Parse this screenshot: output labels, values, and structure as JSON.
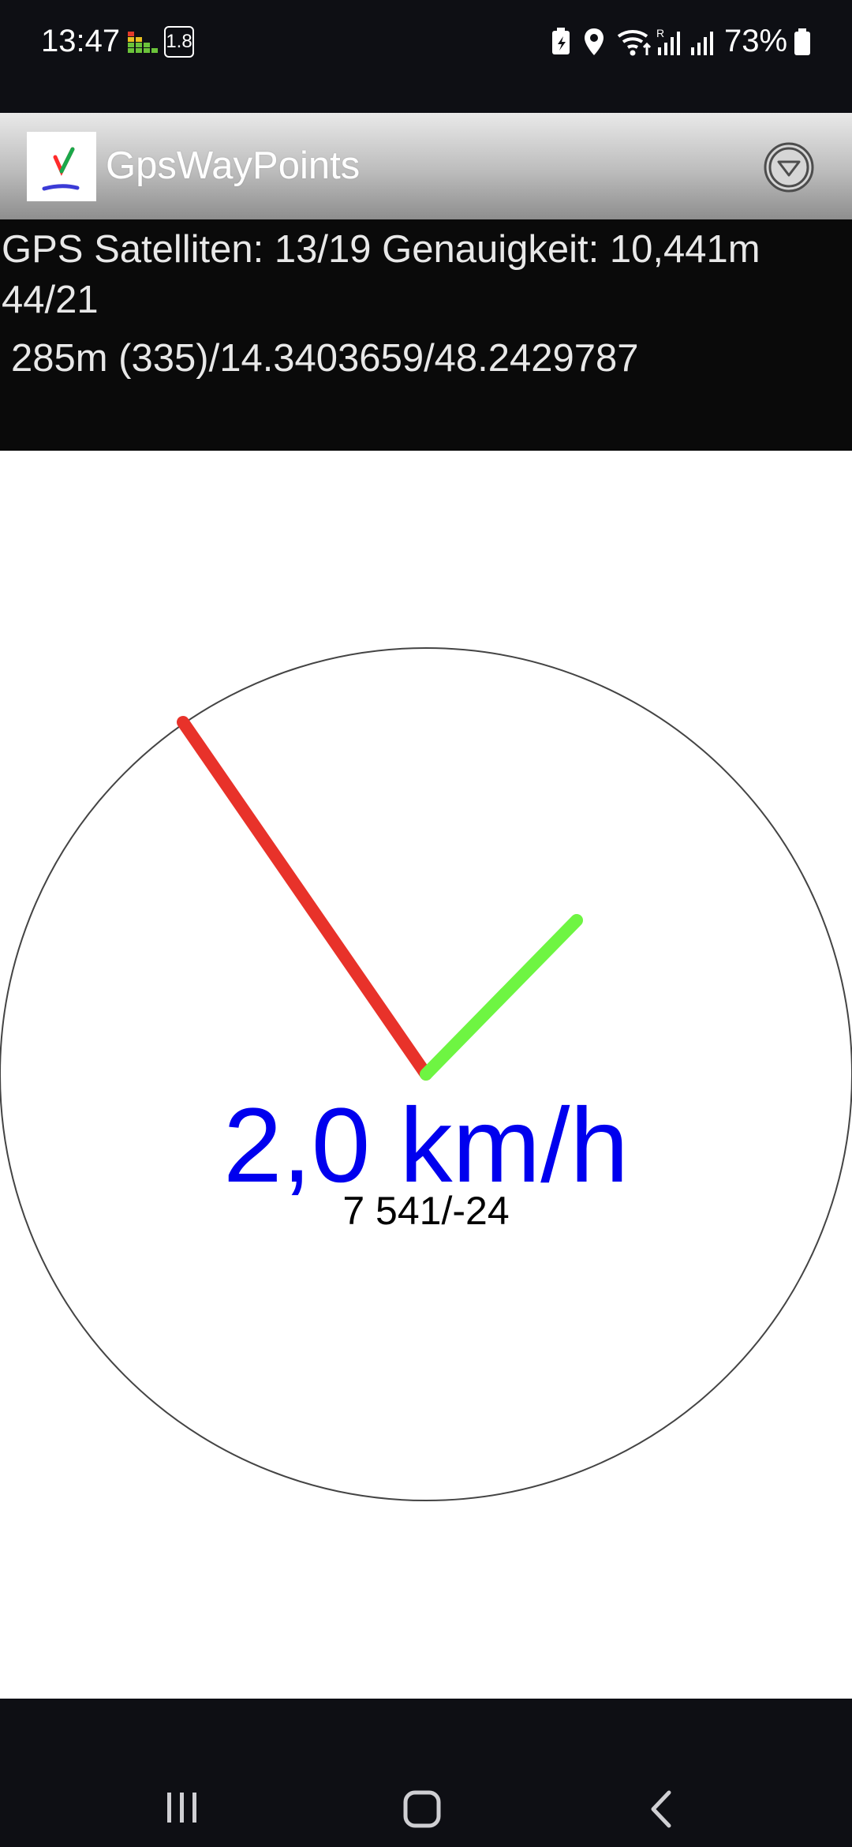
{
  "status_bar": {
    "time": "13:47",
    "speed_badge": "1.8",
    "battery_percent": "73%",
    "icons": [
      "equalizer-icon",
      "speed-badge",
      "battery-saver-icon",
      "location-icon",
      "wifi-icon",
      "signal-r-icon",
      "signal-icon",
      "battery-icon"
    ]
  },
  "app_bar": {
    "title": "GpsWayPoints",
    "menu_icon": "dropdown-circle-icon"
  },
  "info": {
    "line1": "GPS Satelliten: 13/19 Genauigkeit: 10,441m",
    "line2": "44/21",
    "line3": "285m (335)/14.3403659/48.2429787"
  },
  "compass": {
    "speed": "2,0 km/h",
    "heading": "7 541/-24",
    "needle_colors": {
      "red": "#e8322a",
      "green": "#6ef542"
    }
  },
  "nav_bar": {
    "icons": [
      "recent-apps-icon",
      "home-icon",
      "back-icon"
    ]
  }
}
